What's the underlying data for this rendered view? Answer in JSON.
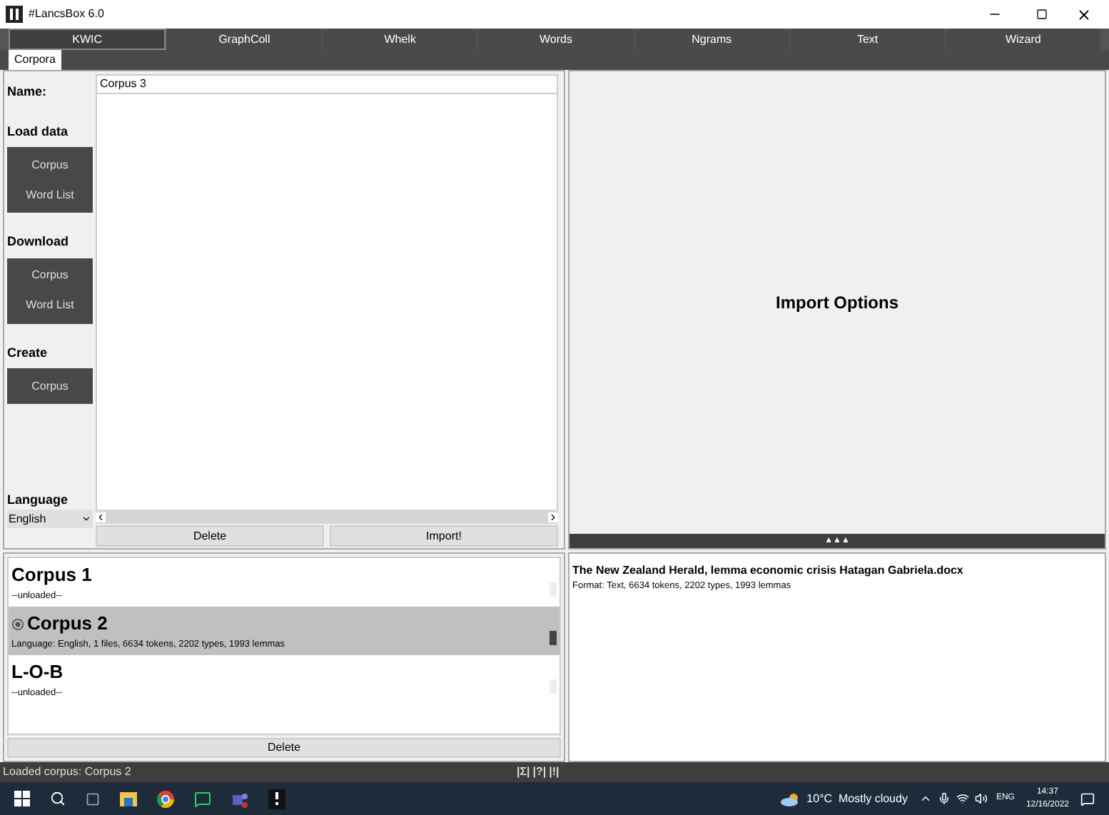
{
  "window": {
    "title": "#LancsBox 6.0"
  },
  "tabs": [
    {
      "label": "KWIC",
      "selected": true
    },
    {
      "label": "GraphColl",
      "selected": false
    },
    {
      "label": "Whelk",
      "selected": false
    },
    {
      "label": "Words",
      "selected": false
    },
    {
      "label": "Ngrams",
      "selected": false
    },
    {
      "label": "Text",
      "selected": false
    },
    {
      "label": "Wizard",
      "selected": false
    }
  ],
  "subtabs": [
    {
      "label": "Corpora",
      "selected": true
    }
  ],
  "sidebar": {
    "name_label": "Name:",
    "sections": [
      {
        "title": "Load data",
        "buttons": [
          "Corpus",
          "Word List"
        ]
      },
      {
        "title": "Download",
        "buttons": [
          "Corpus",
          "Word List"
        ]
      },
      {
        "title": "Create",
        "buttons": [
          "Corpus"
        ]
      }
    ],
    "language_label": "Language",
    "language": "English"
  },
  "name_field": {
    "value": "Corpus 3"
  },
  "buttons": [
    "Delete",
    "Import!"
  ],
  "import_options": {
    "title": "Import Options",
    "collapse": "▲▲▲"
  },
  "corpora": [
    {
      "name": "Corpus 1",
      "info": "--unloaded--",
      "selected": false
    },
    {
      "name": "Corpus 2",
      "info": "Language: English, 1 files, 6634 tokens, 2202 types, 1993 lemmas",
      "selected": true
    },
    {
      "name": "L-O-B",
      "info": "--unloaded--",
      "selected": false
    }
  ],
  "corpora_delete": "Delete",
  "file": {
    "name": "The New Zealand Herald, lemma economic crisis Hatagan Gabriela.docx",
    "info": "Format: Text, 6634 tokens, 2202 types, 1993 lemmas"
  },
  "status_bar": {
    "text": "Loaded corpus: Corpus 2",
    "indicators": [
      "|Σ|",
      "|?|",
      "|!|"
    ]
  },
  "taskbar": {
    "weather": "10°C  Mostly cloudy",
    "language": "ENG",
    "time": "14:37",
    "date": "12/16/2022"
  }
}
